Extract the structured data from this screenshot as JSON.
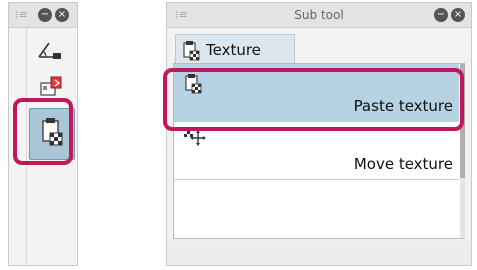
{
  "left_palette": {
    "tools": [
      {
        "icon": "ruler-tool-icon"
      },
      {
        "icon": "frame-tool-icon"
      },
      {
        "icon": "texture-tool-icon",
        "selected": true
      }
    ]
  },
  "sub_tool": {
    "title": "Sub tool",
    "tab": {
      "label": "Texture",
      "icon": "texture-icon"
    },
    "items": [
      {
        "label": "Paste texture",
        "icon": "paste-texture-icon",
        "selected": true
      },
      {
        "label": "Move texture",
        "icon": "move-texture-icon",
        "selected": false
      }
    ]
  },
  "colors": {
    "highlight": "#c2185b",
    "selection": "#b7d2e2"
  }
}
